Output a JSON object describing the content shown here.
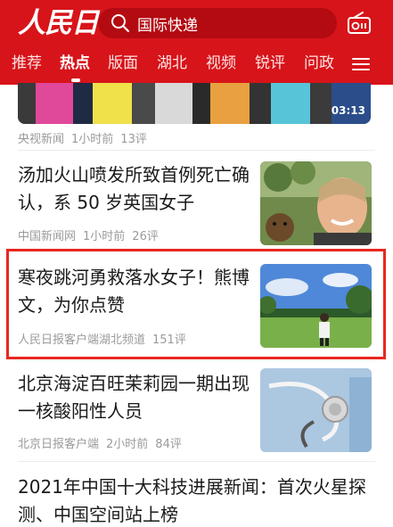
{
  "header": {
    "logo": "人民日報",
    "search_placeholder": "国际快递",
    "nav": [
      "推荐",
      "热点",
      "版面",
      "湖北",
      "视频",
      "锐评",
      "问政"
    ],
    "active_tab": "热点"
  },
  "colors": {
    "brand_red": "#d7141a",
    "highlight_border": "#e8271f"
  },
  "icons": {
    "search": "search-icon",
    "radio": "radio-icon",
    "menu": "menu-icon"
  },
  "video": {
    "duration": "03:13",
    "source": "央视新闻",
    "time": "1小时前",
    "comments": "13评"
  },
  "articles": [
    {
      "title": "汤加火山喷发所致首例死亡确认，系 50 岁英国女子",
      "source": "中国新闻网",
      "time": "1小时前",
      "comments": "26评"
    },
    {
      "title": "寒夜跳河勇救落水女子！熊博文，为你点赞",
      "source": "人民日报客户端湖北频道",
      "time": "",
      "comments": "151评"
    },
    {
      "title": "北京海淀百旺茉莉园一期出现一核酸阳性人员",
      "source": "北京日报客户端",
      "time": "2小时前",
      "comments": "84评"
    },
    {
      "title": "2021年中国十大科技进展新闻：首次火星探测、中国空间站上榜"
    }
  ]
}
